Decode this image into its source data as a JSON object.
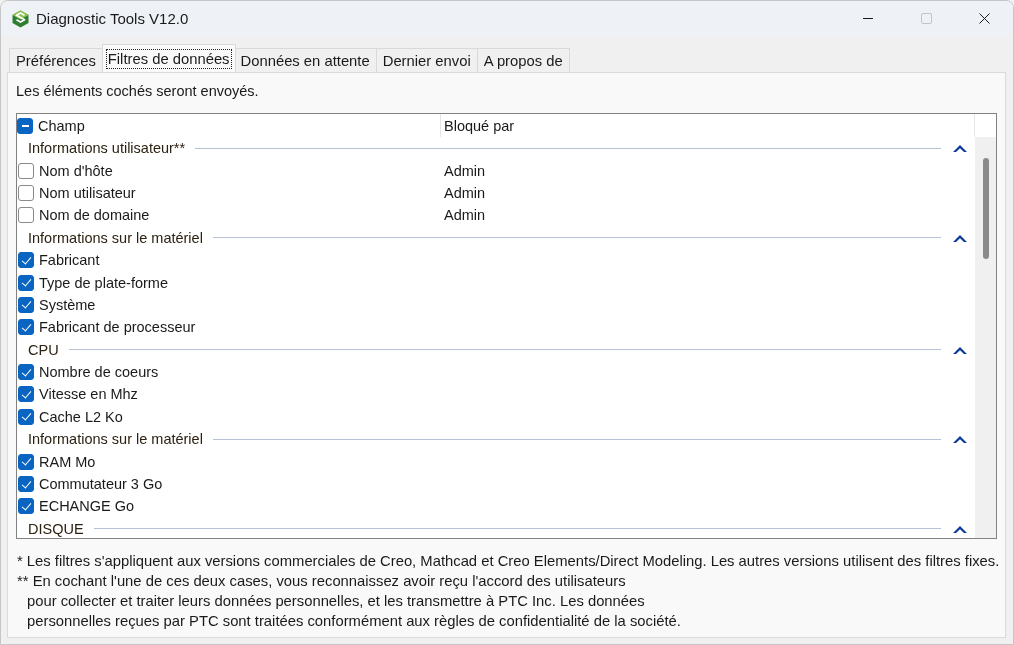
{
  "window": {
    "title": "Diagnostic Tools V12.0",
    "maximize_disabled": true
  },
  "tabs": [
    {
      "label": "Préférences",
      "selected": false
    },
    {
      "label": "Filtres de données",
      "selected": true
    },
    {
      "label": "Données en attente",
      "selected": false
    },
    {
      "label": "Dernier envoi",
      "selected": false
    },
    {
      "label": "A propos de",
      "selected": false
    }
  ],
  "instruction": "Les éléments cochés seront envoyés.",
  "filter_list": {
    "header": {
      "indeterminate": true,
      "columns": [
        "Champ",
        "Bloqué par"
      ]
    },
    "groups": [
      {
        "title": "Informations utilisateur**",
        "expanded": true,
        "items": [
          {
            "label": "Nom d'hôte",
            "checked": false,
            "blocked_by": "Admin"
          },
          {
            "label": "Nom utilisateur",
            "checked": false,
            "blocked_by": "Admin"
          },
          {
            "label": "Nom de domaine",
            "checked": false,
            "blocked_by": "Admin"
          }
        ]
      },
      {
        "title": "Informations sur le matériel",
        "expanded": true,
        "items": [
          {
            "label": "Fabricant",
            "checked": true
          },
          {
            "label": "Type de plate-forme",
            "checked": true
          },
          {
            "label": "Système",
            "checked": true
          },
          {
            "label": "Fabricant de processeur",
            "checked": true
          }
        ]
      },
      {
        "title": "CPU",
        "expanded": true,
        "items": [
          {
            "label": "Nombre de coeurs",
            "checked": true
          },
          {
            "label": "Vitesse en Mhz",
            "checked": true
          },
          {
            "label": "Cache L2 Ko",
            "checked": true
          }
        ]
      },
      {
        "title": "Informations sur le matériel",
        "expanded": true,
        "items": [
          {
            "label": "RAM Mo",
            "checked": true
          },
          {
            "label": "Commutateur 3 Go",
            "checked": true
          },
          {
            "label": "ECHANGE Go",
            "checked": true
          }
        ]
      },
      {
        "title": "DISQUE",
        "expanded": true
      }
    ]
  },
  "footnotes": [
    {
      "lines": [
        "* Les filtres s'appliquent aux versions commerciales de Creo, Mathcad et Creo Elements/Direct Modeling. Les autres versions utilisent des filtres fixes."
      ]
    },
    {
      "lines": [
        "** En cochant l'une de ces deux cases, vous reconnaissez avoir reçu l'accord des utilisateurs",
        "pour collecter et traiter leurs données personnelles, et les transmettre à PTC Inc. Les données",
        "personnelles reçues par PTC sont traitées conformément aux règles de confidentialité de la société."
      ]
    }
  ]
}
